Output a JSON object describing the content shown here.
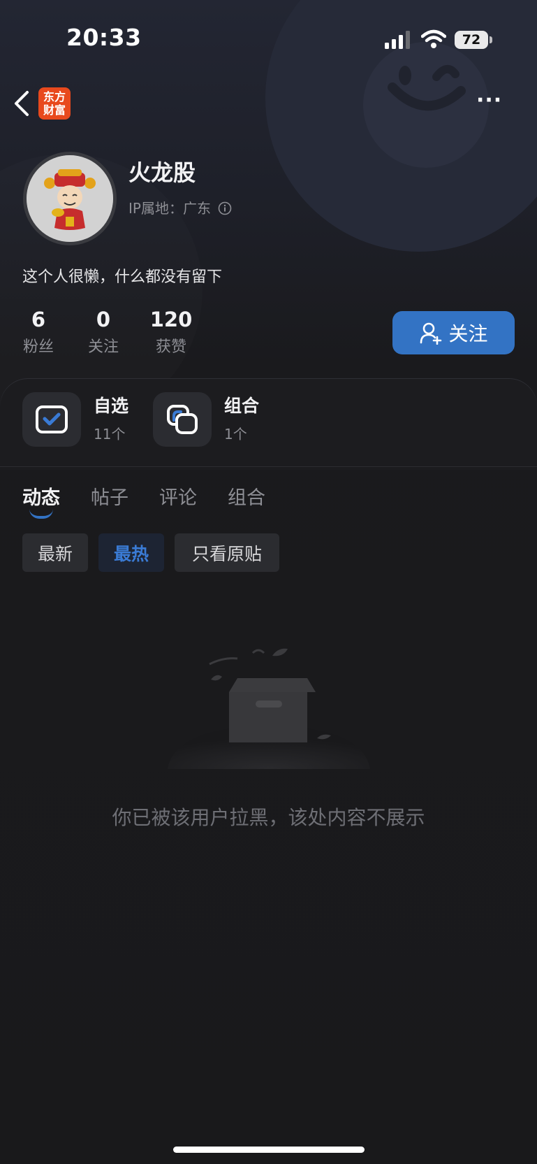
{
  "status_bar": {
    "time": "20:33",
    "battery": "72"
  },
  "header": {
    "logo_text_line1": "东方",
    "logo_text_line2": "财富",
    "more_label": "···"
  },
  "profile": {
    "username": "火龙股",
    "ip_location": "IP属地：广东",
    "bio": "这个人很懒，什么都没有留下",
    "stats": [
      {
        "value": "6",
        "label": "粉丝"
      },
      {
        "value": "0",
        "label": "关注"
      },
      {
        "value": "120",
        "label": "获赞"
      }
    ],
    "follow_label": "关注"
  },
  "shortcuts": [
    {
      "title": "自选",
      "sub": "11个"
    },
    {
      "title": "组合",
      "sub": "1个"
    }
  ],
  "tabs": [
    {
      "label": "动态"
    },
    {
      "label": "帖子"
    },
    {
      "label": "评论"
    },
    {
      "label": "组合"
    }
  ],
  "filters": [
    {
      "label": "最新"
    },
    {
      "label": "最热"
    },
    {
      "label": "只看原贴"
    }
  ],
  "empty_state": {
    "message": "你已被该用户拉黑，该处内容不展示"
  },
  "colors": {
    "accent": "#3373c4",
    "background": "#19191b",
    "logo": "#e8491d"
  }
}
